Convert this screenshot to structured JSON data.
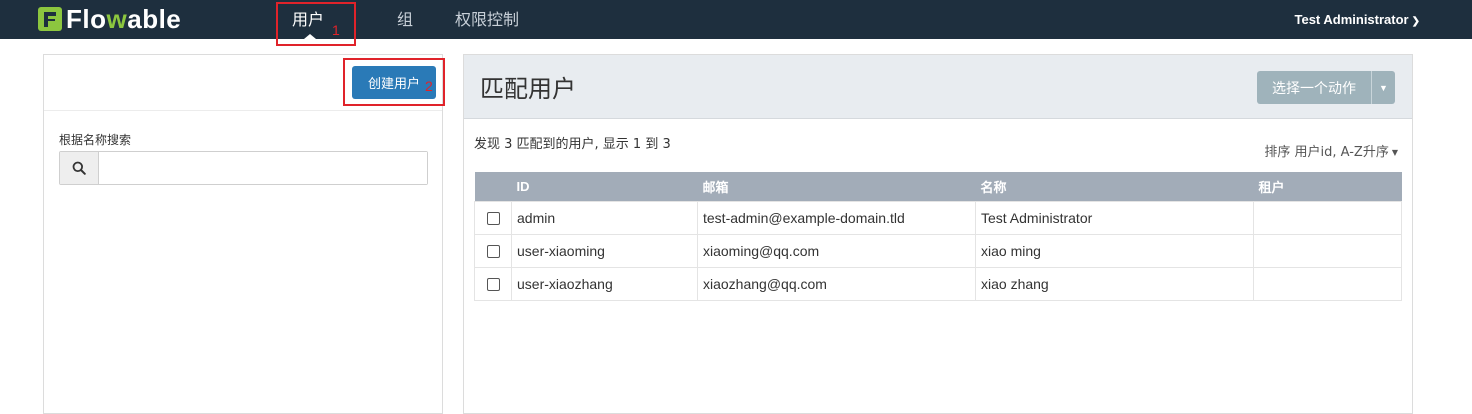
{
  "navbar": {
    "logo_text_a": "Flo",
    "logo_text_w": "w",
    "logo_text_b": "able",
    "items": [
      {
        "label": "用户",
        "active": true
      },
      {
        "label": "组",
        "active": false
      },
      {
        "label": "权限控制",
        "active": false
      }
    ],
    "user_menu": "Test Administrator",
    "user_menu_icon": "chevron-down-icon"
  },
  "annotations": {
    "num1": "1",
    "num2": "2",
    "color": "#e0232a"
  },
  "left_panel": {
    "create_button": "创建用户",
    "search_label": "根据名称搜索",
    "search_value": "",
    "search_placeholder": "",
    "search_icon": "search-icon"
  },
  "right_panel": {
    "title": "匹配用户",
    "action_button": "选择一个动作",
    "found_text": "发现 3 匹配到的用户, 显示 1 到 3",
    "sort_text": "排序 用户id, A-Z升序",
    "columns": [
      "ID",
      "邮箱",
      "名称",
      "租户"
    ],
    "rows": [
      {
        "id": "admin",
        "email": "test-admin@example-domain.tld",
        "name": "Test Administrator",
        "tenant": ""
      },
      {
        "id": "user-xiaoming",
        "email": "xiaoming@qq.com",
        "name": "xiao ming",
        "tenant": ""
      },
      {
        "id": "user-xiaozhang",
        "email": "xiaozhang@qq.com",
        "name": "xiao zhang",
        "tenant": ""
      }
    ]
  },
  "colors": {
    "navbar_bg": "#1e2f3e",
    "brand_green": "#8cc63f",
    "primary_button": "#2a7ab7",
    "action_button": "#9fb3bb",
    "table_header": "#a2acb8"
  }
}
